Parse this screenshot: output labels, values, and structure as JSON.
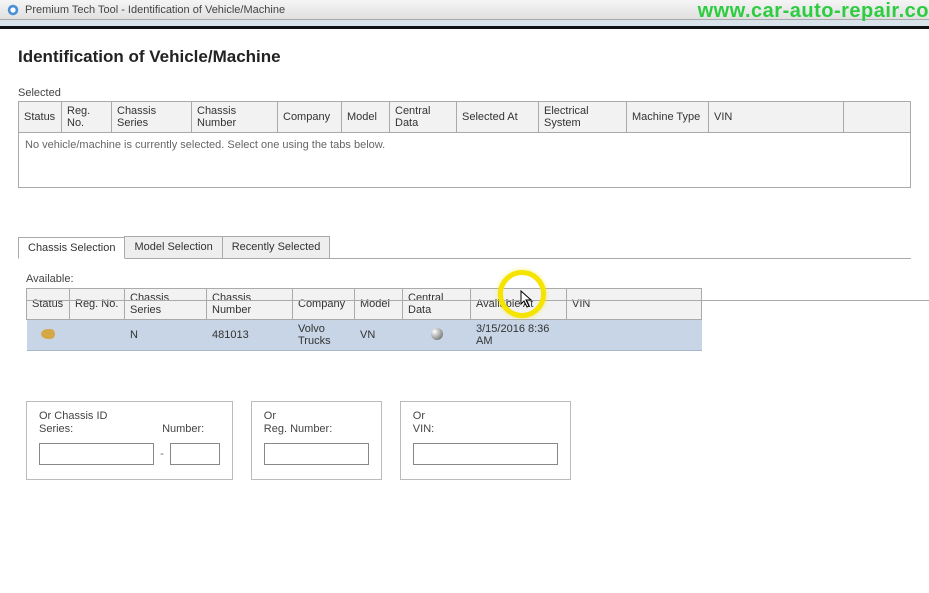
{
  "window": {
    "title": "Premium Tech Tool - Identification of Vehicle/Machine"
  },
  "watermark": "www.car-auto-repair.co",
  "page_title": "Identification of Vehicle/Machine",
  "selected": {
    "label": "Selected",
    "headers": [
      "Status",
      "Reg. No.",
      "Chassis Series",
      "Chassis Number",
      "Company",
      "Model",
      "Central Data",
      "Selected At",
      "Electrical System",
      "Machine Type",
      "VIN"
    ],
    "message": "No vehicle/machine is currently selected. Select one using the tabs below."
  },
  "tabs": [
    {
      "id": "chassis",
      "label": "Chassis Selection",
      "active": true
    },
    {
      "id": "model",
      "label": "Model Selection",
      "active": false
    },
    {
      "id": "recent",
      "label": "Recently Selected",
      "active": false
    }
  ],
  "available": {
    "label": "Available:",
    "headers": [
      "Status",
      "Reg. No.",
      "Chassis Series",
      "Chassis Number",
      "Company",
      "Model",
      "Central Data",
      "Available At",
      "VIN"
    ],
    "row": {
      "status_icon": "key-icon",
      "reg_no": "",
      "chassis_series": "N",
      "chassis_number": "481013",
      "company": "Volvo Trucks",
      "model": "VN",
      "central_data_icon": "dot",
      "available_at": "3/15/2016 8:36 AM",
      "vin": ""
    }
  },
  "filters": {
    "chassis": {
      "label": "Or Chassis ID",
      "series_label": "Series:",
      "number_label": "Number:"
    },
    "reg": {
      "label": "Or",
      "sub": "Reg. Number:"
    },
    "vin": {
      "label": "Or",
      "sub": "VIN:"
    }
  }
}
